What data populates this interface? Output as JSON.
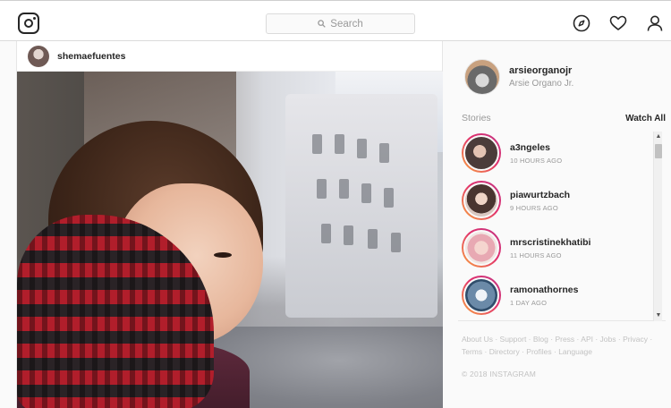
{
  "header": {
    "search_placeholder": "Search",
    "icons": [
      "instagram-logo",
      "compass-icon",
      "heart-icon",
      "person-icon"
    ]
  },
  "post": {
    "username": "shemaefuentes"
  },
  "sidebar": {
    "profile": {
      "username": "arsieorganojr",
      "full_name": "Arsie Organo Jr."
    },
    "stories_title": "Stories",
    "watch_all": "Watch All",
    "stories": [
      {
        "username": "a3ngeles",
        "time": "10 HOURS AGO"
      },
      {
        "username": "piawurtzbach",
        "time": "9 HOURS AGO"
      },
      {
        "username": "mrscristinekhatibi",
        "time": "11 HOURS AGO"
      },
      {
        "username": "ramonathornes",
        "time": "1 DAY AGO"
      }
    ],
    "footer_links": [
      "About Us",
      "Support",
      "Blog",
      "Press",
      "API",
      "Jobs",
      "Privacy",
      "Terms",
      "Directory",
      "Profiles",
      "Language"
    ],
    "copyright": "© 2018 INSTAGRAM"
  },
  "colors": {
    "story_ring_start": "#f9a73e",
    "story_ring_mid": "#e1306c",
    "story_ring_end": "#c13584"
  }
}
